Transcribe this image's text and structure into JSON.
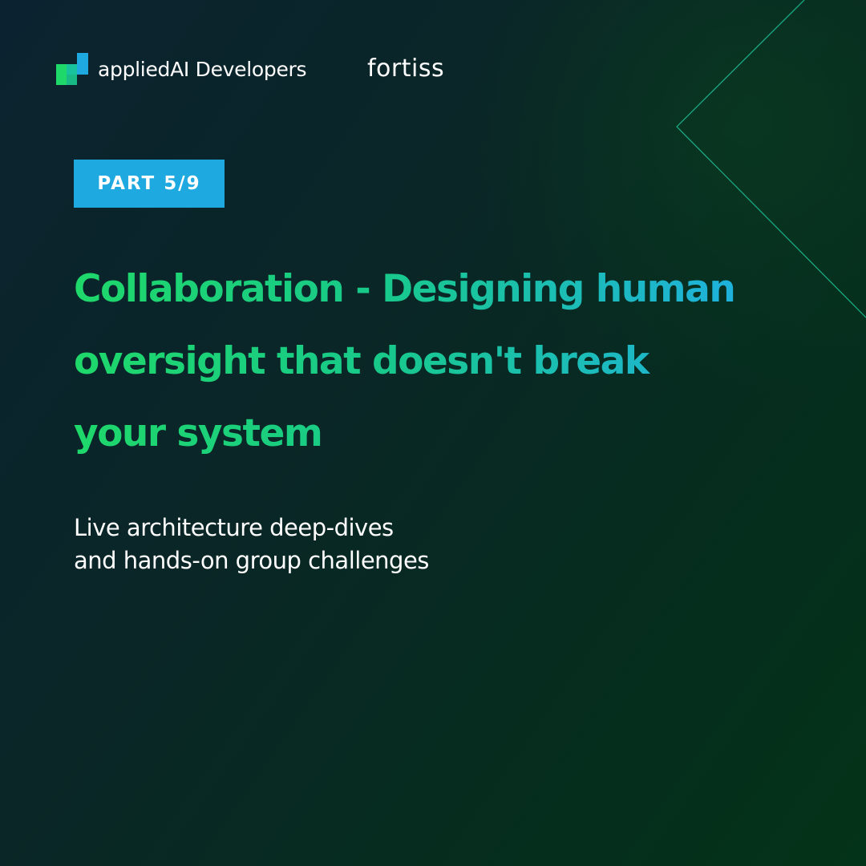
{
  "colors": {
    "background_start": "#0b2330",
    "background_end": "#033318",
    "accent_blue": "#1fa9e1",
    "headline_green": "#1fd86a",
    "headline_blue": "#1fb0e0",
    "decorative_line": "#1fd0a0"
  },
  "header": {
    "applied_logo": {
      "icon": "applied-ai-stairs-icon",
      "text": "appliedAI Developers"
    },
    "fortiss_logo": {
      "text": "fortiss"
    }
  },
  "badge": {
    "label": "PART 5/9"
  },
  "headline": {
    "lines": [
      "Collaboration - Designing human",
      "oversight that doesn't break",
      "your system"
    ]
  },
  "subtitle": {
    "lines": [
      "Live architecture deep-dives",
      "and hands-on group challenges"
    ]
  }
}
